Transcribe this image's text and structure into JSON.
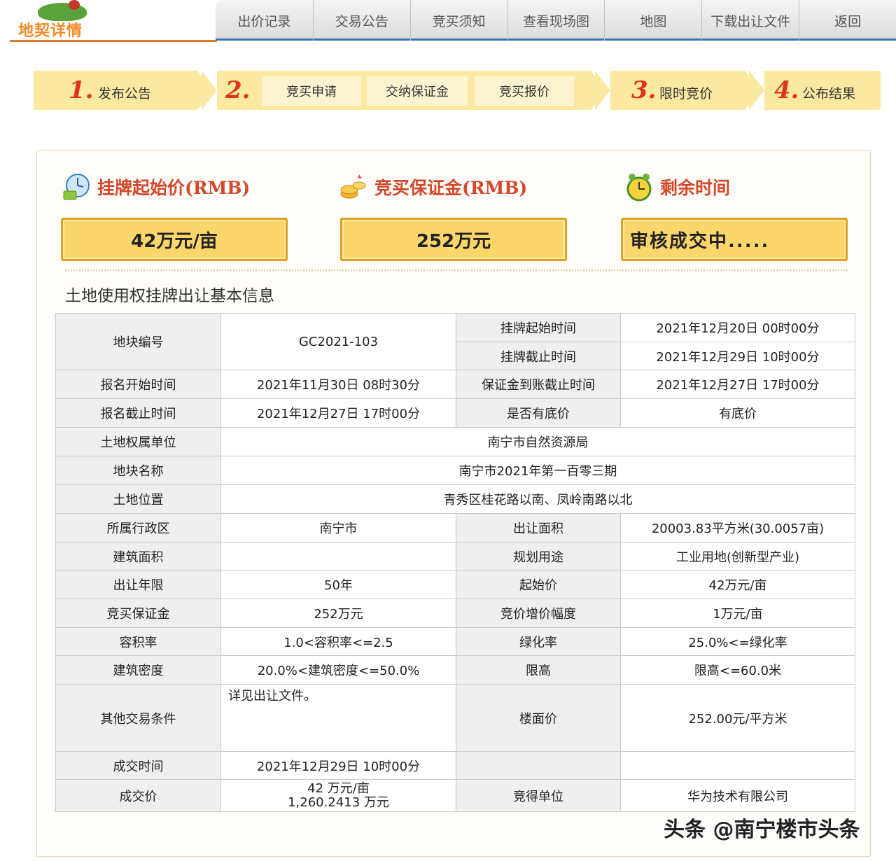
{
  "logo": {
    "text": "地契详情"
  },
  "nav": {
    "items": [
      "出价记录",
      "交易公告",
      "竞买须知",
      "查看现场图",
      "地图",
      "下载出让文件",
      "返回"
    ]
  },
  "steps": {
    "step1": {
      "num": "1.",
      "label": "发布公告"
    },
    "step2": {
      "num": "2.",
      "substeps": [
        "竞买申请",
        "交纳保证金",
        "竞买报价"
      ]
    },
    "step3": {
      "num": "3.",
      "label": "限时竞价"
    },
    "step4": {
      "num": "4.",
      "label": "公布结果"
    }
  },
  "summary": {
    "start_price": {
      "title": "挂牌起始价(RMB)",
      "value": "42万元/亩"
    },
    "deposit": {
      "title": "竞买保证金(RMB)",
      "value": "252万元"
    },
    "remaining": {
      "title": "剩余时间",
      "value": "审核成交中....."
    }
  },
  "info": {
    "title": "土地使用权挂牌出让基本信息",
    "rows": {
      "parcel_no_label": "地块编号",
      "parcel_no": "GC2021-103",
      "list_start_label": "挂牌起始时间",
      "list_start": "2021年12月20日 00时00分",
      "list_end_label": "挂牌截止时间",
      "list_end": "2021年12月29日 10时00分",
      "reg_start_label": "报名开始时间",
      "reg_start": "2021年11月30日 08时30分",
      "deposit_deadline_label": "保证金到账截止时间",
      "deposit_deadline": "2021年12月27日 17时00分",
      "reg_end_label": "报名截止时间",
      "reg_end": "2021年12月27日 17时00分",
      "reserve_label": "是否有底价",
      "reserve": "有底价",
      "owner_label": "土地权属单位",
      "owner": "南宁市自然资源局",
      "parcel_name_label": "地块名称",
      "parcel_name": "南宁市2021年第一百零三期",
      "location_label": "土地位置",
      "location": "青秀区桂花路以南、凤岭南路以北",
      "district_label": "所属行政区",
      "district": "南宁市",
      "area_label": "出让面积",
      "area": "20003.83平方米(30.0057亩)",
      "build_area_label": "建筑面积",
      "build_area": "",
      "use_label": "规划用途",
      "use": "工业用地(创新型产业)",
      "term_label": "出让年限",
      "term": "50年",
      "start_price_label": "起始价",
      "start_price": "42万元/亩",
      "deposit_label": "竞买保证金",
      "deposit": "252万元",
      "increment_label": "竞价增价幅度",
      "increment": "1万元/亩",
      "far_label": "容积率",
      "far": "1.0<容积率<=2.5",
      "green_label": "绿化率",
      "green": "25.0%<=绿化率",
      "density_label": "建筑密度",
      "density": "20.0%<建筑密度<=50.0%",
      "height_label": "限高",
      "height": "限高<=60.0米",
      "other_label": "其他交易条件",
      "other": "详见出让文件。",
      "floor_price_label": "楼面价",
      "floor_price": "252.00元/平方米",
      "deal_time_label": "成交时间",
      "deal_time": "2021年12月29日 10时00分",
      "deal_price_label": "成交价",
      "deal_price_unit": "42 万元/亩",
      "deal_price_total": "1,260.2413 万元",
      "winner_label": "竞得单位",
      "winner": "华为技术有限公司"
    }
  },
  "watermark": "头条 @南宁楼市头条",
  "colors": {
    "accent": "#d4472a",
    "nav_border": "#3a6fb0",
    "step_bg": "#fbe9a2",
    "value_box": "#fbd76b"
  },
  "icons": [
    "clock-money-icon",
    "coins-icon",
    "alarm-clock-icon"
  ]
}
